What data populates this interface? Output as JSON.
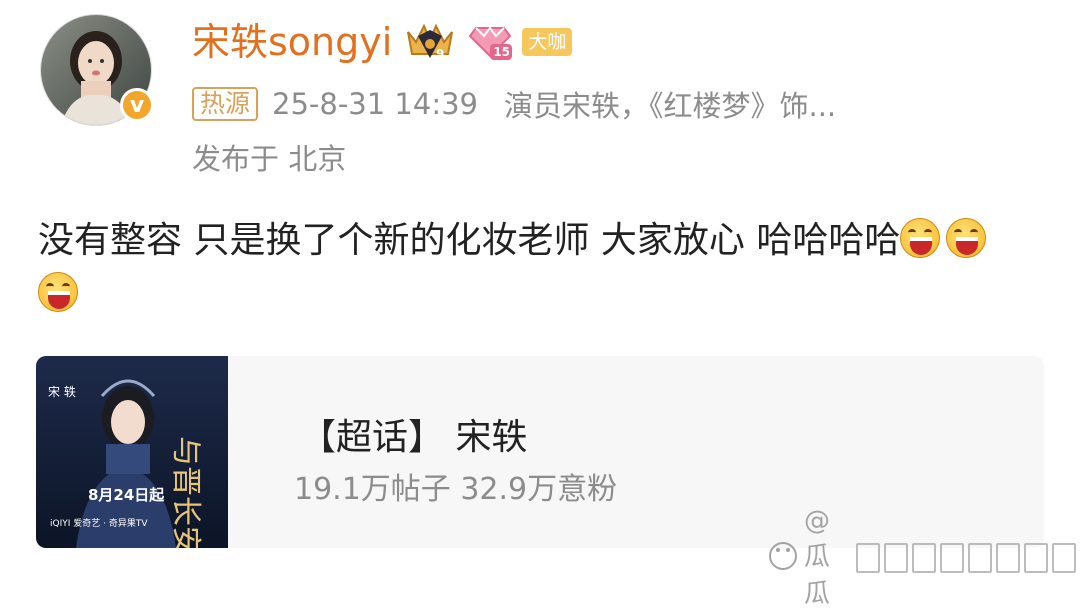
{
  "user": {
    "name": "宋轶songyi",
    "verified_mark": "v",
    "badge_level": "15",
    "daka_label": "大咖"
  },
  "meta": {
    "tag": "热源",
    "time": "25-8-31 14:39",
    "source": "演员宋轶，《红楼梦》饰...",
    "location": "发布于 北京"
  },
  "post": {
    "text": "没有整容 只是换了个新的化妆老师 大家放心 哈哈哈哈",
    "emojis": [
      "laugh-emoji",
      "laugh-emoji",
      "laugh-emoji"
    ]
  },
  "card": {
    "title": "【超话】 宋轶",
    "stats": "19.1万帖子 32.9万意粉",
    "poster": {
      "title": "与晋长安",
      "date": "8月24日起",
      "platform": "iQIYI 爱奇艺 · 奇异果TV",
      "name_vertical": "宋 轶"
    }
  },
  "watermark": {
    "text": "@瓜瓜"
  },
  "colors": {
    "username": "#e2701f",
    "meta_gray": "#8c8c8c",
    "hot_tag": "#d8a25a",
    "card_bg": "#f7f7f7"
  }
}
